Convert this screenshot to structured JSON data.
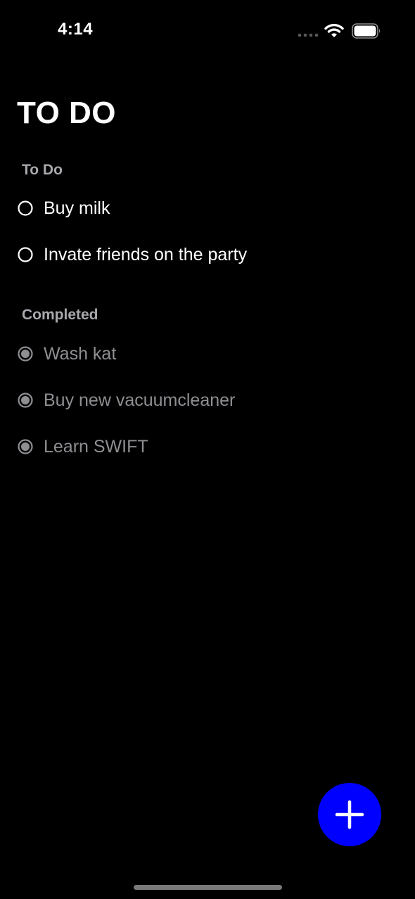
{
  "status_bar": {
    "time": "4:14",
    "icons": [
      "cellular-signal-icon",
      "wifi-icon",
      "battery-icon"
    ]
  },
  "page": {
    "title": "TO DO"
  },
  "sections": {
    "todo": {
      "header": "To Do",
      "items": [
        {
          "label": "Buy milk",
          "completed": false
        },
        {
          "label": "Invate friends on the party",
          "completed": false
        }
      ]
    },
    "completed": {
      "header": "Completed",
      "items": [
        {
          "label": "Wash kat",
          "completed": true
        },
        {
          "label": "Buy new vacuumcleaner",
          "completed": true
        },
        {
          "label": "Learn SWIFT",
          "completed": true
        }
      ]
    }
  },
  "add_button": {
    "icon": "plus-icon"
  },
  "colors": {
    "background": "#000000",
    "fab": "#0000ff",
    "section_header": "#a8a8ad",
    "completed_text": "#8e8e93",
    "open_text": "#ffffff"
  }
}
